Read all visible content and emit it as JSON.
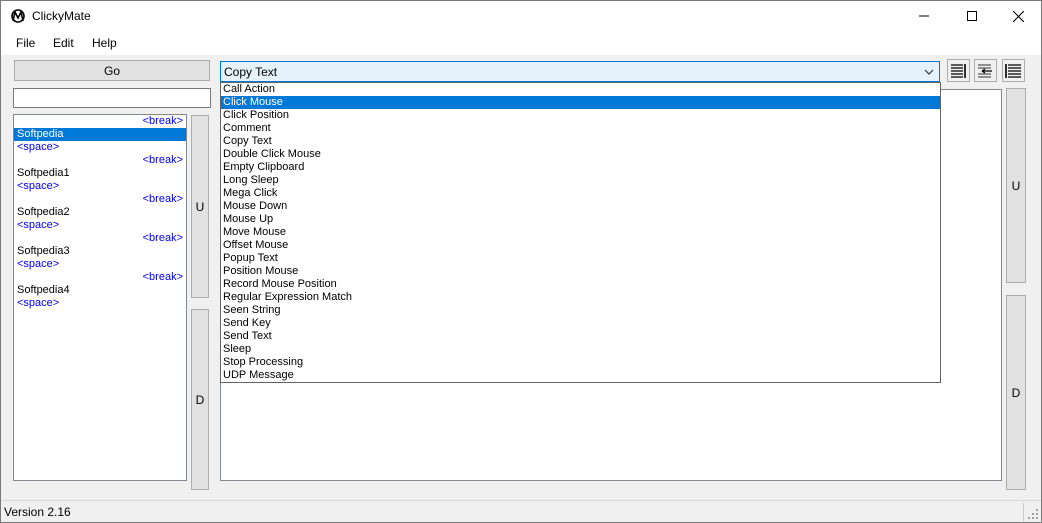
{
  "window": {
    "title": "ClickyMate"
  },
  "menu": {
    "file": "File",
    "edit": "Edit",
    "help": "Help"
  },
  "left": {
    "go_label": "Go",
    "command_value": "",
    "up_label": "U",
    "down_label": "D",
    "items": [
      {
        "kind": "break",
        "text": "<break>"
      },
      {
        "kind": "name",
        "text": "Softpedia",
        "selected": true
      },
      {
        "kind": "space",
        "text": "<space>"
      },
      {
        "kind": "break",
        "text": "<break>"
      },
      {
        "kind": "name",
        "text": "Softpedia1"
      },
      {
        "kind": "space",
        "text": "<space>"
      },
      {
        "kind": "break",
        "text": "<break>"
      },
      {
        "kind": "name",
        "text": "Softpedia2"
      },
      {
        "kind": "space",
        "text": "<space>"
      },
      {
        "kind": "break",
        "text": "<break>"
      },
      {
        "kind": "name",
        "text": "Softpedia3"
      },
      {
        "kind": "space",
        "text": "<space>"
      },
      {
        "kind": "break",
        "text": "<break>"
      },
      {
        "kind": "name",
        "text": "Softpedia4"
      },
      {
        "kind": "space",
        "text": "<space>"
      }
    ]
  },
  "action": {
    "selected_value": "Copy Text",
    "highlighted": "Click Mouse",
    "options": [
      "Call Action",
      "Click Mouse",
      "Click Position",
      "Comment",
      "Copy Text",
      "Double Click Mouse",
      "Empty Clipboard",
      "Long Sleep",
      "Mega Click",
      "Mouse Down",
      "Mouse Up",
      "Move Mouse",
      "Offset Mouse",
      "Popup Text",
      "Position Mouse",
      "Record Mouse Position",
      "Regular Expression Match",
      "Seen String",
      "Send Key",
      "Send Text",
      "Sleep",
      "Stop Processing",
      "UDP Message"
    ]
  },
  "toolbar": {
    "icons": [
      "insert-line-icon",
      "replace-line-icon",
      "wrap-lines-icon"
    ]
  },
  "right": {
    "up_label": "U",
    "down_label": "D"
  },
  "status": {
    "version": "Version 2.16"
  },
  "colors": {
    "selection": "#0078d7",
    "link_blue": "#0000ee",
    "combo_border": "#0078d7"
  }
}
